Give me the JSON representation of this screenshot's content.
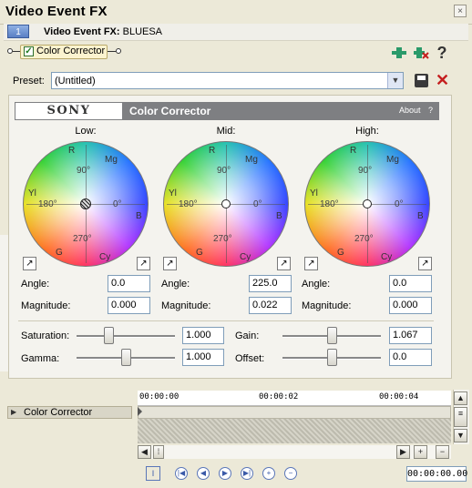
{
  "window": {
    "title": "Video Event FX",
    "close_glyph": "×"
  },
  "chain": {
    "index": "1",
    "prefix": "Video Event FX:",
    "clip": "BLUESA"
  },
  "plugin": {
    "name": "Color Corrector",
    "enabled": true,
    "check_glyph": "✓"
  },
  "toolbar": {
    "icons": [
      "plug-in-chain-icon",
      "remove-plug-in-icon",
      "help-icon"
    ],
    "help_glyph": "?"
  },
  "preset": {
    "label": "Preset:",
    "value": "(Untitled)",
    "dropdown_glyph": "▼",
    "delete_glyph": "✕"
  },
  "header": {
    "brand": "SONY",
    "fx_name": "Color Corrector",
    "about": "About",
    "help": "?"
  },
  "wheels": [
    {
      "label": "Low:",
      "angle": "0.0",
      "magnitude": "0.000",
      "marker": "center-hatched"
    },
    {
      "label": "Mid:",
      "angle": "225.0",
      "magnitude": "0.022",
      "marker": "circle"
    },
    {
      "label": "High:",
      "angle": "0.0",
      "magnitude": "0.000",
      "marker": "circle"
    }
  ],
  "wheel_text": {
    "r": "R",
    "mg": "Mg",
    "yl": "Yl",
    "b": "B",
    "g": "G",
    "cy": "Cy",
    "d90": "90°",
    "d180": "180°",
    "d0": "0°",
    "d270": "270°"
  },
  "fields": {
    "angle_label": "Angle:",
    "magnitude_label": "Magnitude:"
  },
  "sliders": {
    "saturation": {
      "label": "Saturation:",
      "value": "1.000",
      "level": 0.33
    },
    "gamma": {
      "label": "Gamma:",
      "value": "1.000",
      "level": 0.5
    },
    "gain": {
      "label": "Gain:",
      "value": "1.067",
      "level": 0.5
    },
    "offset": {
      "label": "Offset:",
      "value": "0.0",
      "level": 0.5
    }
  },
  "timeline": {
    "track_label": "Color Corrector",
    "ruler": [
      "00:00:00",
      "00:00:02",
      "00:00:04"
    ],
    "timecode": "00:00:00.00",
    "plus": "+",
    "minus": "−"
  },
  "colors": {
    "sony_bar": "#7e7f82",
    "delete": "#c41e1e",
    "add": "#2a9a6a"
  }
}
